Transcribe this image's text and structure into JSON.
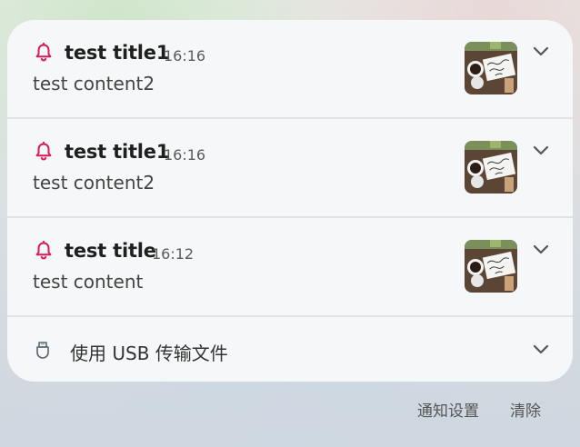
{
  "notifications": [
    {
      "title": "test title1",
      "time": "16:16",
      "content": "test content2",
      "icon": "bell-icon",
      "thumbnail": "coffee-note-photo"
    },
    {
      "title": "test title1",
      "time": "16:16",
      "content": "test content2",
      "icon": "bell-icon",
      "thumbnail": "coffee-note-photo"
    },
    {
      "title": "test title",
      "time": "16:12",
      "content": "test content",
      "icon": "bell-icon",
      "thumbnail": "coffee-note-photo"
    }
  ],
  "usb": {
    "label": "使用 USB 传输文件",
    "icon": "usb-icon"
  },
  "footer": {
    "settings_label": "通知设置",
    "clear_label": "清除"
  },
  "colors": {
    "accent": "#d81b60",
    "card_bg": "#f6f7f8"
  }
}
